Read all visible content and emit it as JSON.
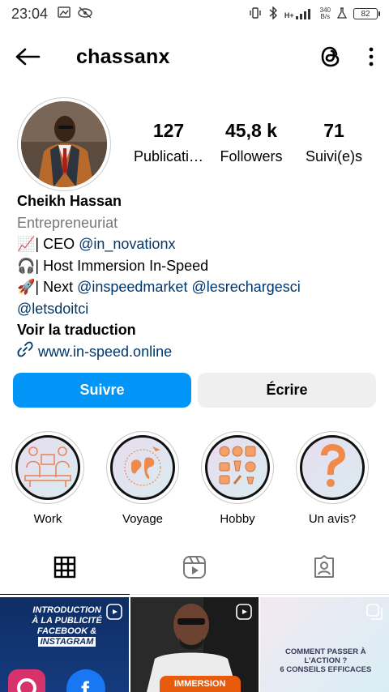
{
  "status_bar": {
    "time": "23:04",
    "network": "H+",
    "speed_value": "340",
    "speed_unit": "B/s",
    "battery": "82"
  },
  "header": {
    "username": "chassanx",
    "back_icon": "arrow-left-icon",
    "threads_icon": "threads-icon",
    "more_icon": "more-vertical-icon"
  },
  "profile": {
    "stats": [
      {
        "value": "127",
        "label": "Publicati…"
      },
      {
        "value": "45,8 k",
        "label": "Followers"
      },
      {
        "value": "71",
        "label": "Suivi(e)s"
      }
    ],
    "name": "Cheikh Hassan",
    "category": "Entrepreneuriat",
    "bio": {
      "line1_prefix": "📈| CEO ",
      "line1_mention": "@in_novationx",
      "line2": "🎧| Host Immersion In-Speed",
      "line3_prefix": "🚀| Next ",
      "line3_mention1": "@inspeedmarket",
      "line3_mention2": "@lesrechargesci",
      "line4_mention": "@letsdoitci"
    },
    "translate_label": "Voir la traduction",
    "website": "www.in-speed.online"
  },
  "actions": {
    "follow_label": "Suivre",
    "message_label": "Écrire"
  },
  "highlights": [
    {
      "label": "Work",
      "icon": "workspace-icon"
    },
    {
      "label": "Voyage",
      "icon": "globe-icon"
    },
    {
      "label": "Hobby",
      "icon": "hobbies-icon"
    },
    {
      "label": "Un avis?",
      "icon": "question-icon"
    }
  ],
  "tabs": [
    {
      "name": "grid",
      "icon": "grid-icon"
    },
    {
      "name": "reels",
      "icon": "reels-icon"
    },
    {
      "name": "tagged",
      "icon": "tagged-icon"
    }
  ],
  "posts": [
    {
      "line1": "INTRODUCTION",
      "line2": "À LA PUBLICITÉ",
      "line3a": "FACEBOOK & ",
      "line3b": "INSTAGRAM"
    },
    {
      "caption": "IMMERSION"
    },
    {
      "line1": "COMMENT PASSER À L'ACTION ?",
      "line2": "6 CONSEILS EFFICACES"
    }
  ],
  "colors": {
    "primary_button": "#0095f6",
    "secondary_button": "#efefef",
    "mention": "#00376b",
    "category": "#777777"
  }
}
